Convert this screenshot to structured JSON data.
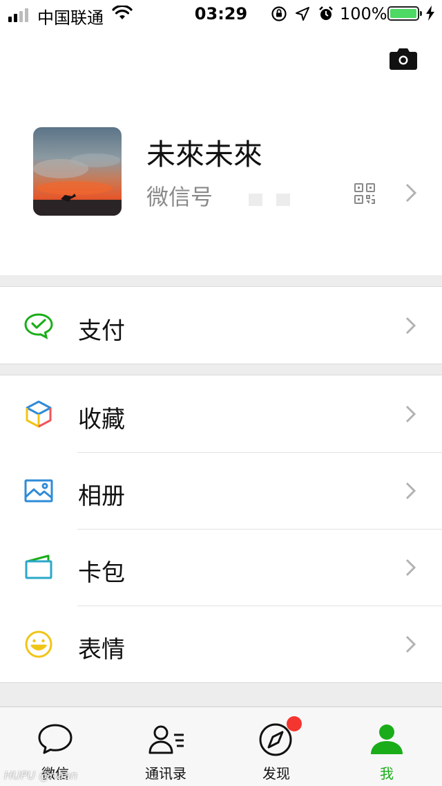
{
  "status_bar": {
    "carrier": "中国联通",
    "time": "03:29",
    "battery_percent": "100%",
    "battery_level": 1.0,
    "signal_bars_filled": 2
  },
  "profile": {
    "nickname": "未來未來",
    "wechat_id_label": "微信号"
  },
  "menu": {
    "pay": {
      "label": "支付",
      "icon": "wechat-pay-icon",
      "color": "#1aad19"
    },
    "favorites": {
      "label": "收藏",
      "icon": "cube-icon"
    },
    "album": {
      "label": "相册",
      "icon": "image-icon",
      "color": "#2f8bd8"
    },
    "cards": {
      "label": "卡包",
      "icon": "card-wallet-icon",
      "color": "#2ba7c9"
    },
    "stickers": {
      "label": "表情",
      "icon": "smile-icon",
      "color": "#f0c516"
    }
  },
  "tabbar": {
    "chats": "微信",
    "contacts": "通讯录",
    "discover": "发现",
    "me": "我",
    "active_color": "#1aad19"
  },
  "watermark": "HUPU @haan"
}
